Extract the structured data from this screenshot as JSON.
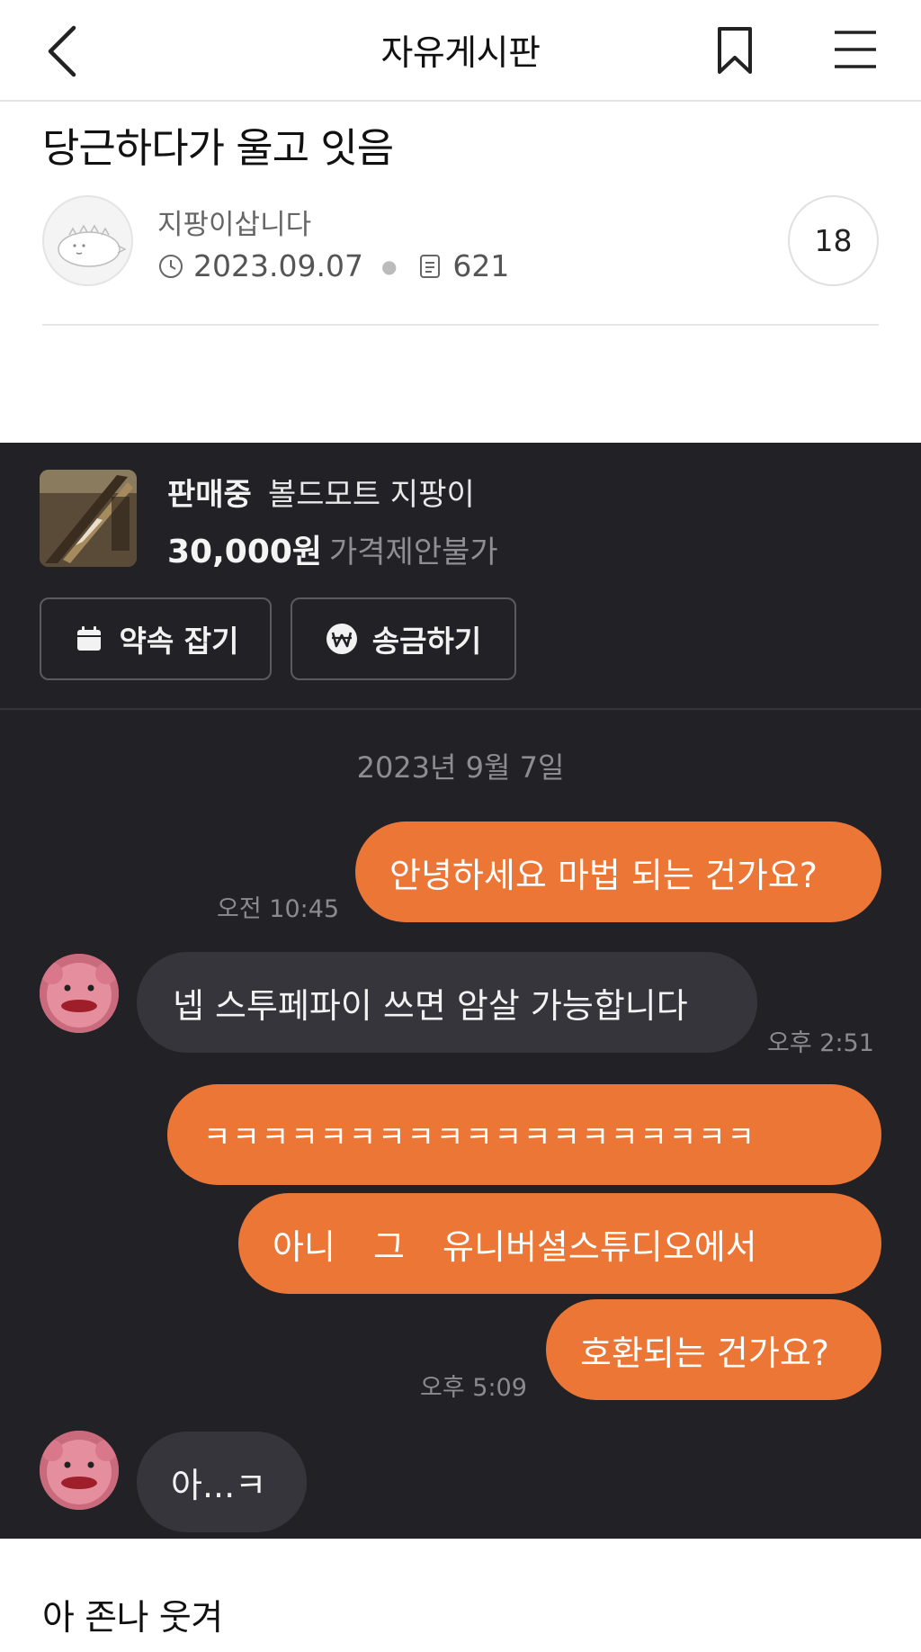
{
  "nav": {
    "title": "자유게시판"
  },
  "post": {
    "title": "당근하다가 울고 잇음",
    "author": "지팡이삽니다",
    "date": "2023.09.07",
    "views": "621",
    "comment_count": "18"
  },
  "chat": {
    "product": {
      "status": "판매중",
      "name": "볼드모트 지팡이",
      "price": "30,000원",
      "negotiation": "가격제안불가"
    },
    "buttons": {
      "appointment": "약속 잡기",
      "send_money": "송금하기"
    },
    "date": "2023년 9월 7일",
    "messages": [
      {
        "side": "me",
        "text": "안녕하세요 마법 되는 건가요?",
        "time": "오전 10:45"
      },
      {
        "side": "them",
        "text": "넵 스투페파이 쓰면 암살 가능합니다",
        "time": "오후 2:51"
      },
      {
        "side": "me",
        "text": "ㅋㅋㅋㅋㅋㅋㅋㅋㅋㅋㅋㅋㅋㅋㅋㅋㅋㅋㅋ",
        "time": ""
      },
      {
        "side": "me",
        "text": "아니 그 유니버셜스튜디오에서",
        "time": ""
      },
      {
        "side": "me",
        "text": "호환되는 건가요?",
        "time": "오후 5:09"
      },
      {
        "side": "them",
        "text": "아...ㅋ",
        "time": ""
      }
    ]
  },
  "caption": "아 존나 웃겨",
  "colors": {
    "accent": "#ec7636",
    "chat_bg": "#222226",
    "bubble_them": "#35353b"
  },
  "icons": [
    "back-chevron-icon",
    "bookmark-icon",
    "hamburger-menu-icon",
    "clock-icon",
    "document-icon",
    "calendar-icon",
    "won-coin-icon"
  ]
}
